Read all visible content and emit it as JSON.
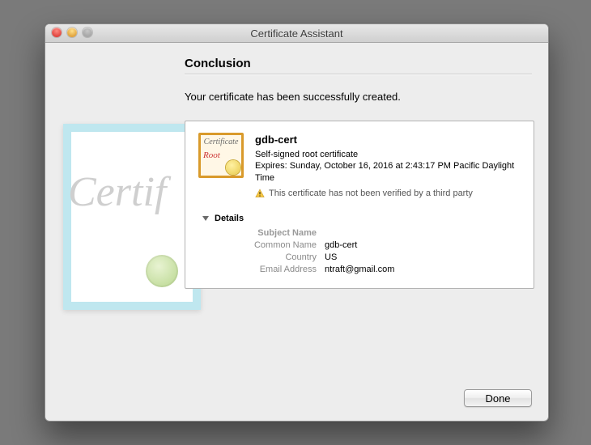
{
  "window": {
    "title": "Certificate Assistant"
  },
  "heading": "Conclusion",
  "message": "Your certificate has been successfully created.",
  "bg_cert": {
    "script_text": "Certif"
  },
  "icon": {
    "word": "Certificate",
    "root": "Root"
  },
  "cert": {
    "name": "gdb-cert",
    "kind": "Self-signed root certificate",
    "expires": "Expires: Sunday, October 16, 2016 at 2:43:17 PM Pacific Daylight Time",
    "warning": "This certificate has not been verified by a third party"
  },
  "details": {
    "header": "Details",
    "section_subject": "Subject Name",
    "common_name_label": "Common Name",
    "common_name": "gdb-cert",
    "country_label": "Country",
    "country": "US",
    "email_label": "Email Address",
    "email": "ntraft@gmail.com"
  },
  "buttons": {
    "done": "Done"
  }
}
